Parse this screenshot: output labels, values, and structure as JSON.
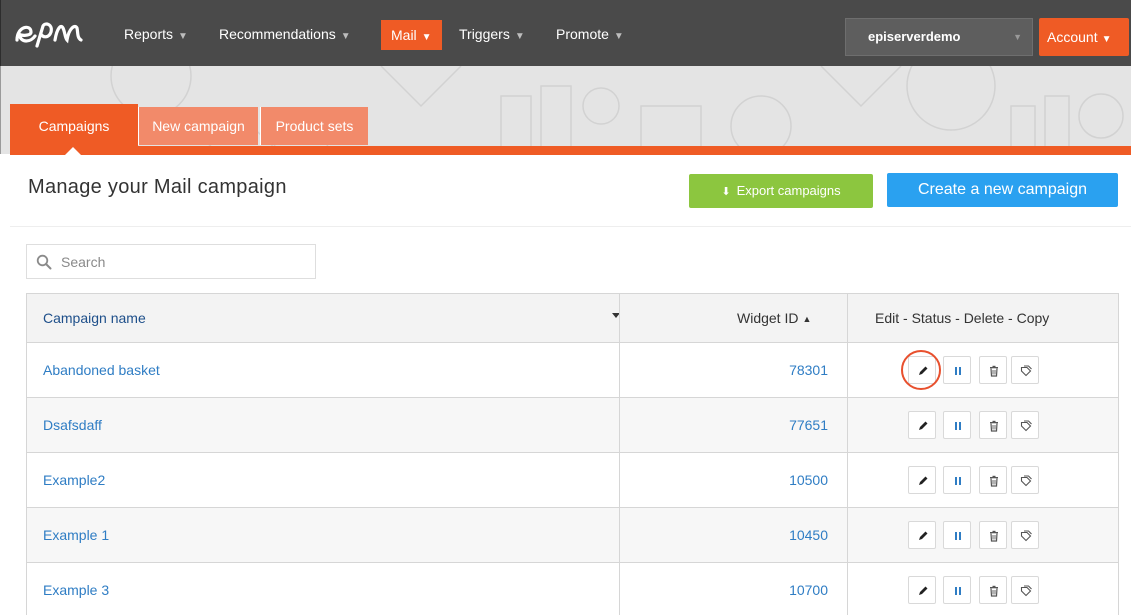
{
  "topnav": {
    "logo_icon": "episerver-logo-icon",
    "items": [
      {
        "label": "Reports",
        "active": false
      },
      {
        "label": "Recommendations",
        "active": false
      },
      {
        "label": "Mail",
        "active": true
      },
      {
        "label": "Triggers",
        "active": false
      },
      {
        "label": "Promote",
        "active": false
      }
    ],
    "site_selector": "episerverdemo",
    "account_label": "Account"
  },
  "tabs": [
    {
      "label": "Campaigns",
      "active": true
    },
    {
      "label": "New campaign",
      "active": false
    },
    {
      "label": "Product sets",
      "active": false
    }
  ],
  "page": {
    "title": "Manage your Mail campaign",
    "export_label": "Export campaigns",
    "create_label": "Create a new campaign"
  },
  "search": {
    "placeholder": "Search",
    "value": ""
  },
  "table": {
    "headers": {
      "name": "Campaign name",
      "widget_id": "Widget ID",
      "actions": "Edit - Status - Delete - Copy"
    },
    "rows": [
      {
        "name": "Abandoned basket",
        "widget_id": "78301"
      },
      {
        "name": "Dsafsdaff",
        "widget_id": "77651"
      },
      {
        "name": "Example2",
        "widget_id": "10500"
      },
      {
        "name": "Example 1",
        "widget_id": "10450"
      },
      {
        "name": "Example 3",
        "widget_id": "10700"
      }
    ]
  },
  "colors": {
    "nav_bg": "#4a4a4a",
    "accent_orange": "#ef5b25",
    "export_green": "#8cc63f",
    "create_blue": "#2aa1f0",
    "link_blue": "#2f7dc4"
  },
  "icons": {
    "export": "download-arrow-icon",
    "search": "search-icon",
    "edit": "pencil-icon",
    "status": "pause-icon",
    "delete": "trash-icon",
    "copy": "copy-icon",
    "sort": "sort-icon"
  }
}
